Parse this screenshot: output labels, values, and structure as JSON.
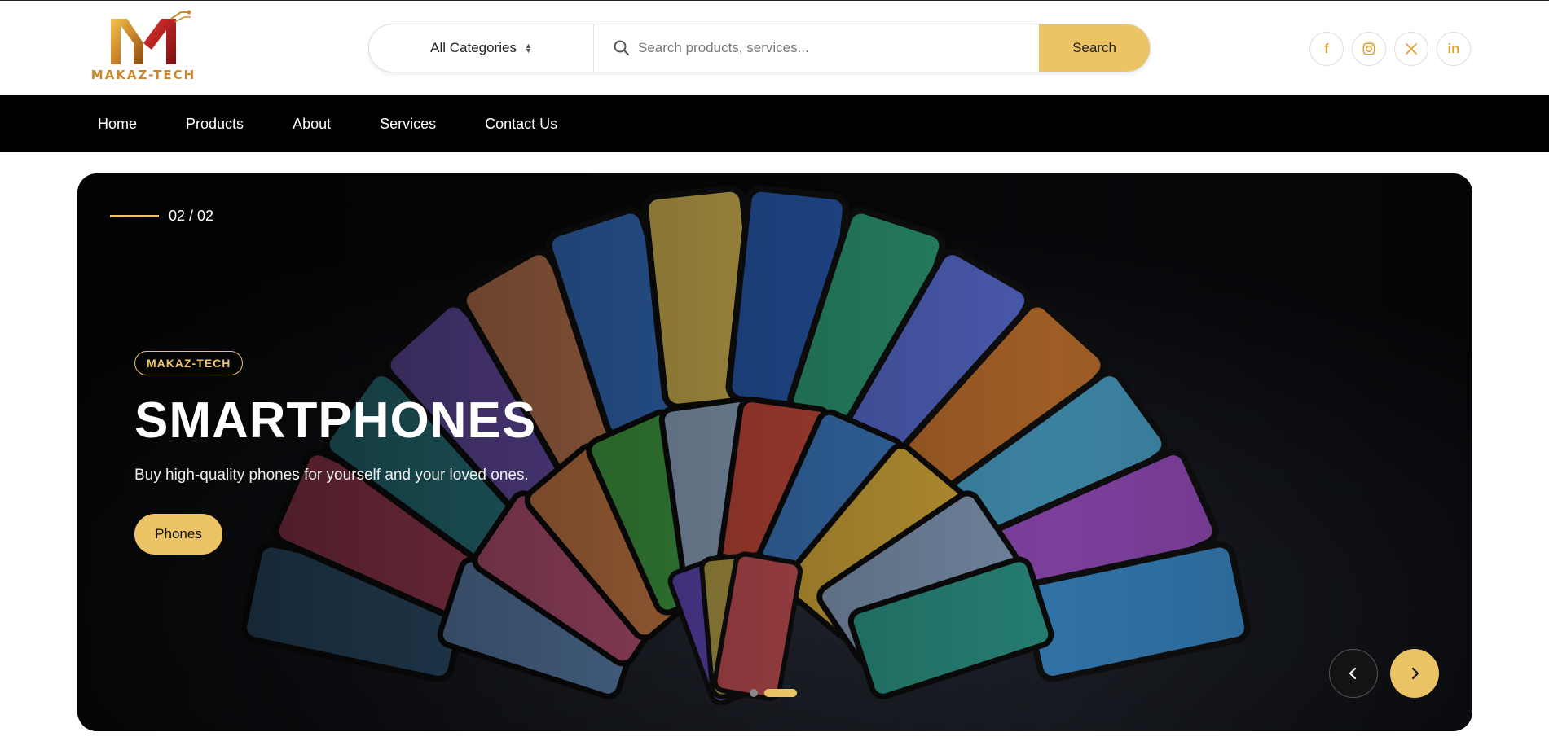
{
  "brand": {
    "name": "MAKAZ-TECH",
    "accent": "#ecc466"
  },
  "search": {
    "category": "All Categories",
    "placeholder": "Search products, services...",
    "button": "Search"
  },
  "socials": [
    {
      "name": "facebook-icon",
      "glyph": "f"
    },
    {
      "name": "instagram-icon"
    },
    {
      "name": "x-icon"
    },
    {
      "name": "linkedin-icon",
      "glyph": "in"
    }
  ],
  "nav": {
    "items": [
      "Home",
      "Products",
      "About",
      "Services",
      "Contact Us"
    ]
  },
  "hero": {
    "counter": "02 / 02",
    "badge": "MAKAZ-TECH",
    "title": "SMARTPHONES",
    "subtitle": "Buy high-quality phones for yourself and your loved ones.",
    "button": "Phones",
    "slides_total": 2,
    "active_slide": 2
  }
}
